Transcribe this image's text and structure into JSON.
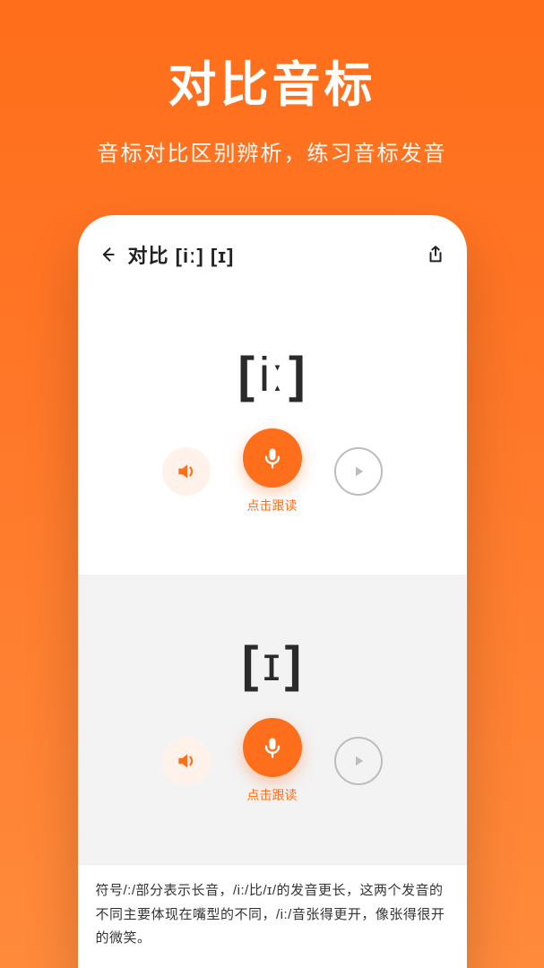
{
  "hero": {
    "title": "对比音标",
    "subtitle": "音标对比区别辨析，练习音标发音"
  },
  "appbar": {
    "title": "对比 [iː] [ɪ]"
  },
  "cards": [
    {
      "symbol": "[iː]",
      "mic_label": "点击跟读"
    },
    {
      "symbol": "[ɪ]",
      "mic_label": "点击跟读"
    }
  ],
  "footer": {
    "text": "符号/:/部分表示长音，/i:/比/ɪ/的发音更长，这两个发音的不同主要体现在嘴型的不同，/i:/音张得更开，像张得很开的微笑。"
  },
  "colors": {
    "accent": "#ff6e1a",
    "speaker_bg": "#fff2ea",
    "play_border": "#bdbdbd"
  }
}
